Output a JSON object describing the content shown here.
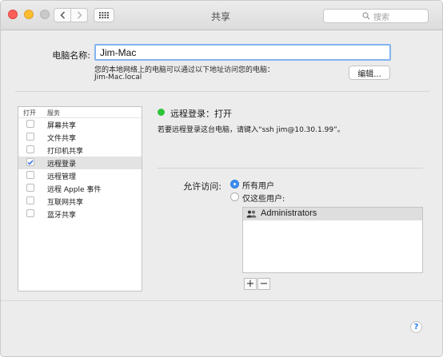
{
  "window": {
    "title": "共享"
  },
  "search": {
    "placeholder": "搜索"
  },
  "computer_name": {
    "label": "电脑名称:",
    "value": "Jim-Mac",
    "description": "您的本地网络上的电脑可以通过以下地址访问您的电脑：",
    "address": "Jim-Mac.local",
    "edit_button": "编辑..."
  },
  "services": {
    "header_on": "打开",
    "header_service": "服务",
    "items": [
      {
        "label": "屏幕共享",
        "checked": false
      },
      {
        "label": "文件共享",
        "checked": false
      },
      {
        "label": "打印机共享",
        "checked": false
      },
      {
        "label": "远程登录",
        "checked": true,
        "selected": true
      },
      {
        "label": "远程管理",
        "checked": false
      },
      {
        "label": "远程 Apple 事件",
        "checked": false
      },
      {
        "label": "互联网共享",
        "checked": false
      },
      {
        "label": "蓝牙共享",
        "checked": false
      }
    ]
  },
  "detail": {
    "status": "远程登录：打开",
    "status_color": "#2ec43a",
    "hint": "若要远程登录这台电脑，请键入“ssh jim@10.30.1.99”。",
    "access_label": "允许访问:",
    "option_all": "所有用户",
    "option_some": "仅这些用户:",
    "selected_option": "所有用户",
    "users": [
      "Administrators"
    ]
  },
  "buttons": {
    "plus": "+",
    "minus": "−",
    "help": "?"
  },
  "colors": {
    "accent": "#3b8ef0",
    "close": "#fc5f57",
    "minimize": "#fdbd2e"
  }
}
